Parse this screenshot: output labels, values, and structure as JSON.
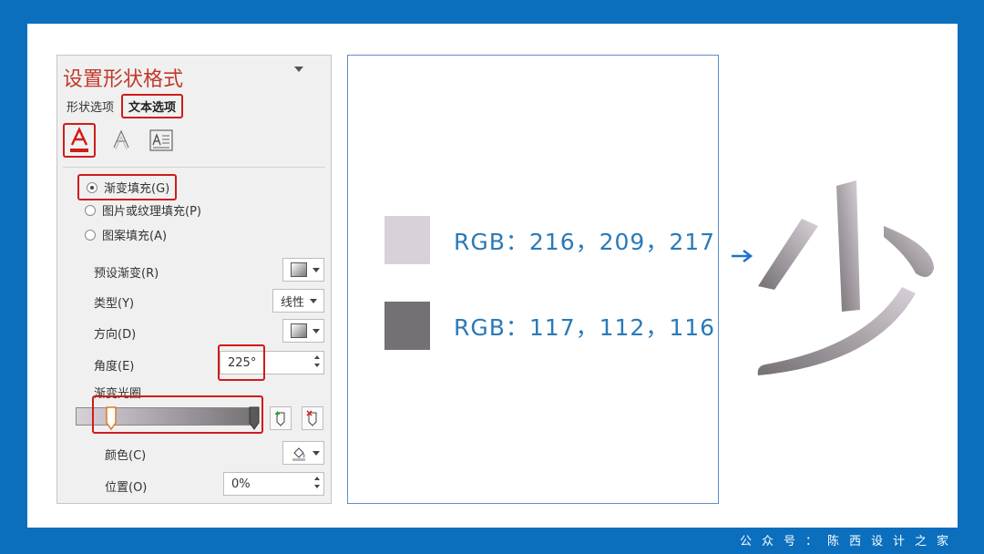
{
  "pane": {
    "title": "设置形状格式",
    "tabs": [
      {
        "label": "形状选项"
      },
      {
        "label": "文本选项"
      }
    ],
    "fill_options": [
      {
        "label": "渐变填充(G)",
        "checked": true
      },
      {
        "label": "图片或纹理填充(P)",
        "checked": false
      },
      {
        "label": "图案填充(A)",
        "checked": false
      }
    ],
    "preset_label": "预设渐变(R)",
    "type_label": "类型(Y)",
    "type_value": "线性",
    "direction_label": "方向(D)",
    "angle_label": "角度(E)",
    "angle_value": "225°",
    "stops_label": "渐变光圈",
    "color_label": "颜色(C)",
    "position_label": "位置(O)",
    "position_value": "0%"
  },
  "swatches": [
    {
      "color": "#d8d1d9",
      "label": "RGB：216，209，217"
    },
    {
      "color": "#757074",
      "label": "RGB：117，112，116"
    }
  ],
  "result_glyph": "少",
  "footer": "公众号：陈西设计之家"
}
